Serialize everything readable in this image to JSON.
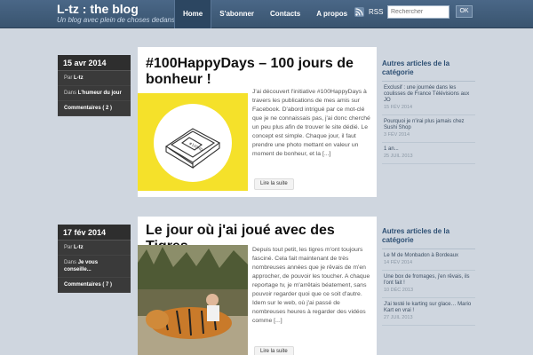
{
  "header": {
    "title": "L-tz : the blog",
    "tagline": "Un blog avec plein de choses dedans",
    "nav": [
      "Home",
      "S'abonner",
      "Contacts",
      "A propos"
    ],
    "rss_label": "RSS",
    "search_placeholder": "Rechercher",
    "search_button": "OK"
  },
  "posts": [
    {
      "date": "15 avr 2014",
      "author_prefix": "Par",
      "author": "L-tz",
      "category_prefix": "Dans",
      "category": "L'humeur du jour",
      "comments": "Commentaires ( 2 )",
      "title": "#100HappyDays – 100 jours de bonheur !",
      "thumb_color": "#f5e12a",
      "excerpt": "J'ai découvert l'initiative #100HappyDays à travers les publications de mes amis sur Facebook. D'abord intrigué par ce mot-clé que je ne connaissais pas, j'ai donc cherché un peu plus afin de trouver le site dédié. Le concept est simple. Chaque jour, il faut prendre une photo mettant en valeur un moment de bonheur, et la [...]",
      "more": "Lire la suite"
    },
    {
      "date": "17 fév 2014",
      "author_prefix": "Par",
      "author": "L-tz",
      "category_prefix": "Dans",
      "category": "Je vous conseille...",
      "comments": "Commentaires ( 7 )",
      "title": "Le jour où j'ai joué avec des Tigres",
      "excerpt": "Depuis tout petit, les tigres m'ont toujours fasciné. Cela fait maintenant de très nombreuses années que je rêvais de m'en approcher, de pouvoir les toucher. A chaque reportage tv, je m'arrêtais béatement, sans pouvoir regarder quoi que ce soit d'autre. Idem sur le web, où j'ai passé de nombreuses heures à regarder des vidéos comme [...]",
      "more": "Lire la suite"
    }
  ],
  "sidebar": [
    {
      "heading": "Autres articles de la catégorie",
      "items": [
        {
          "title": "Exclusif : une journée dans les coulisses de France Télévisions aux JO",
          "date": "15 FÉV 2014"
        },
        {
          "title": "Pourquoi je n'irai plus jamais chez Sushi Shop",
          "date": "3 FÉV 2014"
        },
        {
          "title": "1 an...",
          "date": "25 JUIL 2013"
        }
      ]
    },
    {
      "heading": "Autres articles de la catégorie",
      "items": [
        {
          "title": "Le M de Monbadon à Bordeaux",
          "date": "14 FÉV 2014"
        },
        {
          "title": "Une box de fromages, j'en rêvais, ils l'ont fait !",
          "date": "10 DÉC 2013"
        },
        {
          "title": "J'ai testé le karting sur glace… Mario Kart en vrai !",
          "date": "27 JUIL 2013"
        }
      ]
    }
  ]
}
